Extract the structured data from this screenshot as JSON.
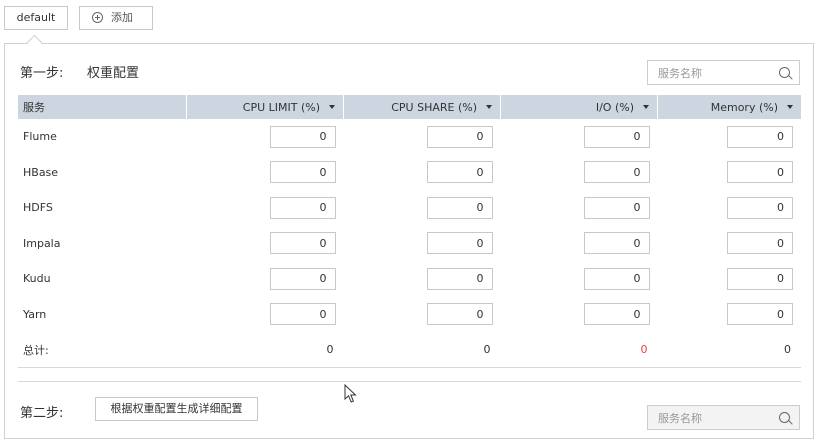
{
  "tabs": {
    "default_label": "default",
    "add_label": "添加"
  },
  "step1": {
    "label": "第一步:",
    "title": "权重配置",
    "search_placeholder": "服务名称"
  },
  "table": {
    "columns": [
      "服务",
      "CPU LIMIT  (%)",
      "CPU SHARE  (%)",
      "I/O  (%)",
      "Memory  (%)"
    ],
    "rows": [
      {
        "service": "Flume",
        "values": [
          "0",
          "0",
          "0",
          "0"
        ]
      },
      {
        "service": "HBase",
        "values": [
          "0",
          "0",
          "0",
          "0"
        ]
      },
      {
        "service": "HDFS",
        "values": [
          "0",
          "0",
          "0",
          "0"
        ]
      },
      {
        "service": "Impala",
        "values": [
          "0",
          "0",
          "0",
          "0"
        ]
      },
      {
        "service": "Kudu",
        "values": [
          "0",
          "0",
          "0",
          "0"
        ]
      },
      {
        "service": "Yarn",
        "values": [
          "0",
          "0",
          "0",
          "0"
        ]
      }
    ],
    "total_label": "总计:",
    "totals": [
      "0",
      "0",
      "0",
      "0"
    ],
    "total_alert_color": "#e0443a"
  },
  "step2": {
    "label": "第二步:",
    "button_label": "根据权重配置生成详细配置",
    "search_placeholder": "服务名称"
  },
  "icons": {
    "add": "plus-circle-icon",
    "search": "search-icon",
    "sort": "arrow-down-icon",
    "cursor": "mouse-cursor-icon"
  },
  "colors": {
    "header_bg": "#ccd5e0",
    "border": "#d0d0d0"
  }
}
